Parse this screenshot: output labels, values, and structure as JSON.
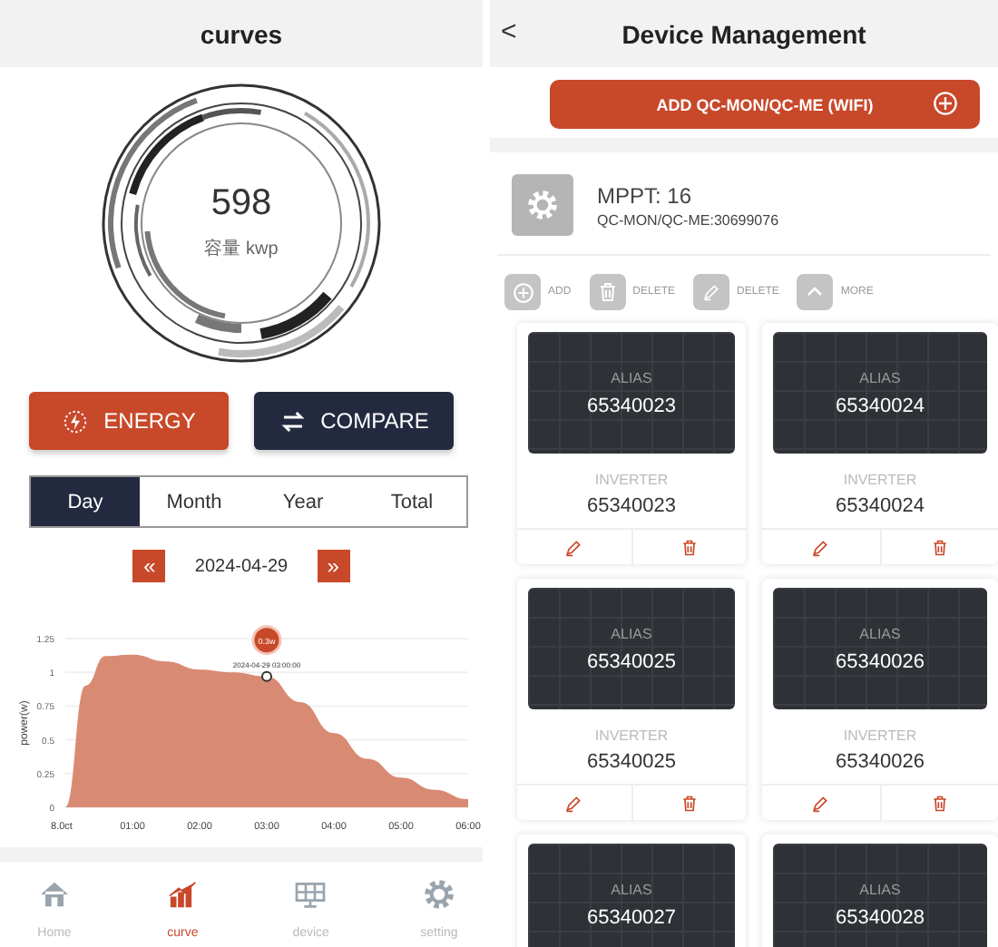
{
  "left": {
    "title": "curves",
    "gauge": {
      "value": "598",
      "unit": "容量 kwp"
    },
    "mode_buttons": [
      {
        "label": "ENERGY",
        "selected": true
      },
      {
        "label": "COMPARE",
        "selected": false
      }
    ],
    "period_tabs": [
      {
        "label": "Day",
        "selected": true
      },
      {
        "label": "Month",
        "selected": false
      },
      {
        "label": "Year",
        "selected": false
      },
      {
        "label": "Total",
        "selected": false
      }
    ],
    "date": {
      "prev": "«",
      "value": "2024-04-29",
      "next": "»"
    },
    "chart": {
      "x_origin_label": "8.0ct",
      "tooltip_value": "0.3w",
      "tooltip_time": "2024-04-29 03:00:00",
      "chart_data": {
        "type": "area",
        "ylabel": "power(w)",
        "x": [
          0,
          0.3,
          0.6,
          1,
          1.5,
          2,
          2.5,
          3,
          3.5,
          4,
          4.5,
          5,
          5.5,
          6
        ],
        "series": [
          {
            "color": "#d98a73",
            "values": [
              0,
              0.9,
              1.12,
              1.13,
              1.08,
              1.02,
              1.0,
              0.97,
              0.78,
              0.55,
              0.36,
              0.22,
              0.13,
              0.06
            ]
          }
        ],
        "xlim": [
          0,
          6
        ],
        "ylim": [
          0,
          1.25
        ],
        "grid": true,
        "xticks": [
          {
            "value": 1,
            "label": "01:00"
          },
          {
            "value": 2,
            "label": "02:00"
          },
          {
            "value": 3,
            "label": "03:00"
          },
          {
            "value": 4,
            "label": "04:00"
          },
          {
            "value": 5,
            "label": "05:00"
          },
          {
            "value": 6,
            "label": "06:00"
          }
        ],
        "yticks": [
          0,
          {
            "value": 0.25,
            "label": "0.25"
          },
          {
            "value": 0.5,
            "label": "0.5"
          },
          {
            "value": 0.75,
            "label": "0.75"
          },
          1,
          {
            "value": 1.25,
            "label": "1.25"
          }
        ]
      }
    },
    "nav": [
      {
        "kind": "home",
        "label": "Home",
        "selected": false
      },
      {
        "kind": "curve",
        "label": "curve",
        "selected": true
      },
      {
        "kind": "device",
        "label": "device",
        "selected": false
      },
      {
        "kind": "setting",
        "label": "setting",
        "selected": false
      }
    ]
  },
  "right": {
    "back": "<",
    "title": "Device Management",
    "add_button": "ADD QC-MON/QC-ME (WIFI)",
    "device": {
      "name": "MPPT: 16",
      "serial": "QC-MON/QC-ME:30699076"
    },
    "actions": [
      {
        "kind": "add",
        "label": "ADD"
      },
      {
        "kind": "delete",
        "label": "DELETE"
      },
      {
        "kind": "edit",
        "label": "DELETE"
      },
      {
        "kind": "more",
        "label": "MORE"
      }
    ],
    "cards": [
      {
        "alias_label": "ALIAS",
        "alias": "65340023",
        "inverter_label": "INVERTER",
        "inverter": "65340023"
      },
      {
        "alias_label": "ALIAS",
        "alias": "65340024",
        "inverter_label": "INVERTER",
        "inverter": "65340024"
      },
      {
        "alias_label": "ALIAS",
        "alias": "65340025",
        "inverter_label": "INVERTER",
        "inverter": "65340025"
      },
      {
        "alias_label": "ALIAS",
        "alias": "65340026",
        "inverter_label": "INVERTER",
        "inverter": "65340026"
      },
      {
        "alias_label": "ALIAS",
        "alias": "65340027"
      },
      {
        "alias_label": "ALIAS",
        "alias": "65340028"
      }
    ]
  }
}
